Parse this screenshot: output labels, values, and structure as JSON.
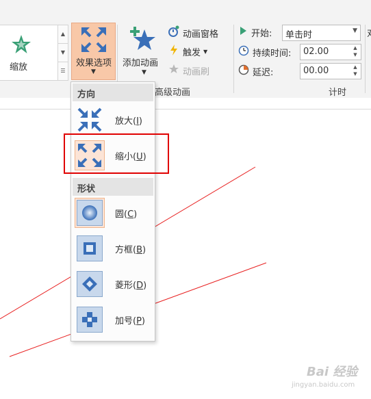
{
  "ribbon": {
    "gallery_label": "缩放",
    "effect_options_label": "效果选项",
    "add_animation_label": "添加动画",
    "animation_pane_label": "动画窗格",
    "trigger_label": "触发",
    "animation_painter_label": "动画刷",
    "advanced_group_label": "高级动画",
    "timing_group_label": "计时",
    "start_label": "开始:",
    "start_value": "单击时",
    "duration_label": "持续时间:",
    "duration_value": "02.00",
    "delay_label": "延迟:",
    "delay_value": "00.00",
    "cutoff_text": "对"
  },
  "menu": {
    "direction_header": "方向",
    "shape_header": "形状",
    "items": [
      {
        "text": "放大(",
        "key": "I",
        "end": ")"
      },
      {
        "text": "缩小(",
        "key": "U",
        "end": ")"
      },
      {
        "text": "圆(",
        "key": "C",
        "end": ")"
      },
      {
        "text": "方框(",
        "key": "B",
        "end": ")"
      },
      {
        "text": "菱形(",
        "key": "D",
        "end": ")"
      },
      {
        "text": "加号(",
        "key": "P",
        "end": ")"
      }
    ]
  },
  "watermark": {
    "logo": "Bai 经验",
    "site": "jingyan.baidu.com"
  },
  "colors": {
    "selected_bg": "#f8c8a8",
    "accent_blue": "#3a6fb8",
    "highlight_red": "#e00000"
  }
}
